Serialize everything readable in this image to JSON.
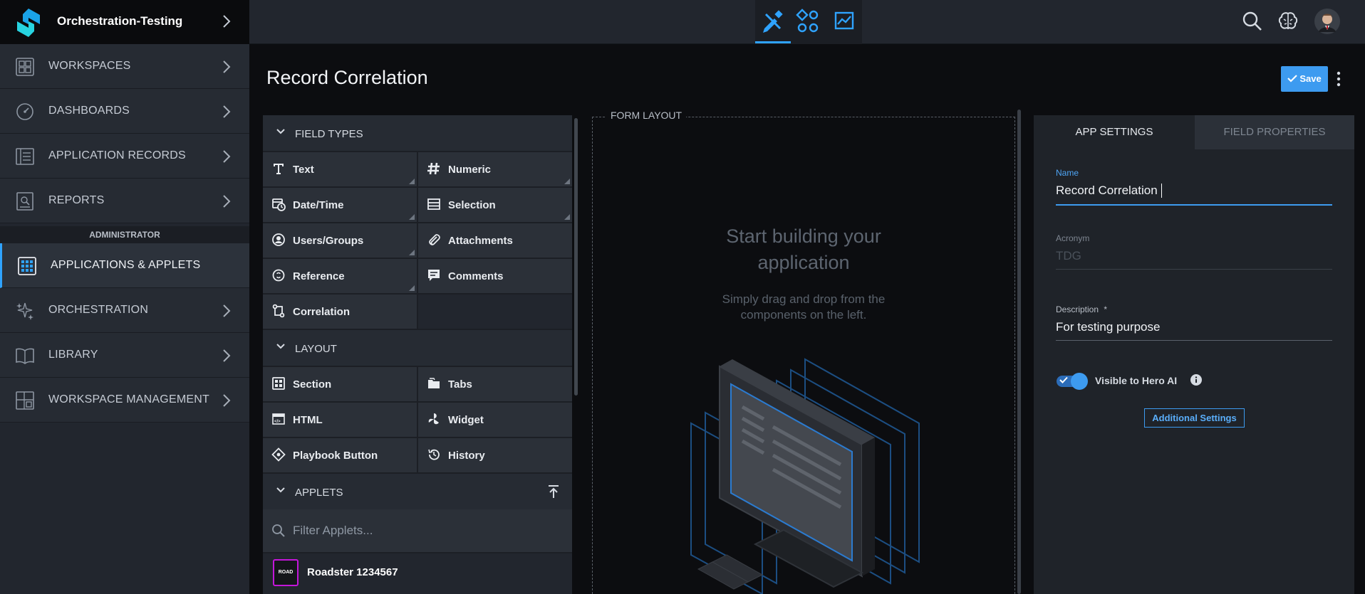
{
  "tenant": {
    "name": "Orchestration-Testing"
  },
  "sidebar": {
    "items": [
      {
        "label": "WORKSPACES",
        "icon": "workspaces-icon"
      },
      {
        "label": "DASHBOARDS",
        "icon": "dashboard-gauge-icon"
      },
      {
        "label": "APPLICATION RECORDS",
        "icon": "records-icon"
      },
      {
        "label": "REPORTS",
        "icon": "reports-icon"
      },
      {
        "label": "APPLICATIONS & APPLETS",
        "icon": "applications-icon",
        "active": true
      },
      {
        "label": "ORCHESTRATION",
        "icon": "sparkles-icon"
      },
      {
        "label": "LIBRARY",
        "icon": "book-icon"
      },
      {
        "label": "WORKSPACE MANAGEMENT",
        "icon": "workspace-management-icon"
      }
    ],
    "admin_header": "ADMINISTRATOR"
  },
  "page": {
    "title": "Record Correlation",
    "save_label": "Save"
  },
  "field_types": {
    "header": "FIELD TYPES",
    "items": [
      {
        "label": "Text",
        "icon": "text-icon"
      },
      {
        "label": "Numeric",
        "icon": "hash-icon"
      },
      {
        "label": "Date/Time",
        "icon": "calendar-clock-icon"
      },
      {
        "label": "Selection",
        "icon": "list-icon"
      },
      {
        "label": "Users/Groups",
        "icon": "user-icon"
      },
      {
        "label": "Attachments",
        "icon": "paperclip-icon"
      },
      {
        "label": "Reference",
        "icon": "reference-icon"
      },
      {
        "label": "Comments",
        "icon": "comment-icon"
      },
      {
        "label": "Correlation",
        "icon": "correlation-icon"
      }
    ]
  },
  "layout": {
    "header": "LAYOUT",
    "items": [
      {
        "label": "Section",
        "icon": "grid-icon"
      },
      {
        "label": "Tabs",
        "icon": "tabs-icon"
      },
      {
        "label": "HTML",
        "icon": "html-icon"
      },
      {
        "label": "Widget",
        "icon": "widget-icon"
      },
      {
        "label": "Playbook Button",
        "icon": "playbook-icon"
      },
      {
        "label": "History",
        "icon": "history-icon"
      }
    ]
  },
  "applets": {
    "header": "APPLETS",
    "filter_placeholder": "Filter Applets...",
    "items": [
      {
        "badge": "ROAD",
        "name": "Roadster 1234567",
        "badge_color": "#c316d9"
      }
    ]
  },
  "form_layout": {
    "legend": "FORM LAYOUT",
    "empty_title_line1": "Start building your",
    "empty_title_line2": "application",
    "empty_sub_line1": "Simply drag and drop from the",
    "empty_sub_line2": "components on the left."
  },
  "settings": {
    "tab_app": "APP SETTINGS",
    "tab_field": "FIELD PROPERTIES",
    "name_label": "Name",
    "name_value": "Record Correlation",
    "acronym_label": "Acronym",
    "acronym_placeholder": "TDG",
    "description_label": "Description",
    "description_required": "*",
    "description_value": "For testing purpose",
    "visible_label": "Visible to Hero AI",
    "visible_on": true,
    "additional_settings": "Additional Settings"
  },
  "colors": {
    "accent": "#3d9bf0",
    "sidebar": "#262b33",
    "badge": "#c316d9"
  }
}
